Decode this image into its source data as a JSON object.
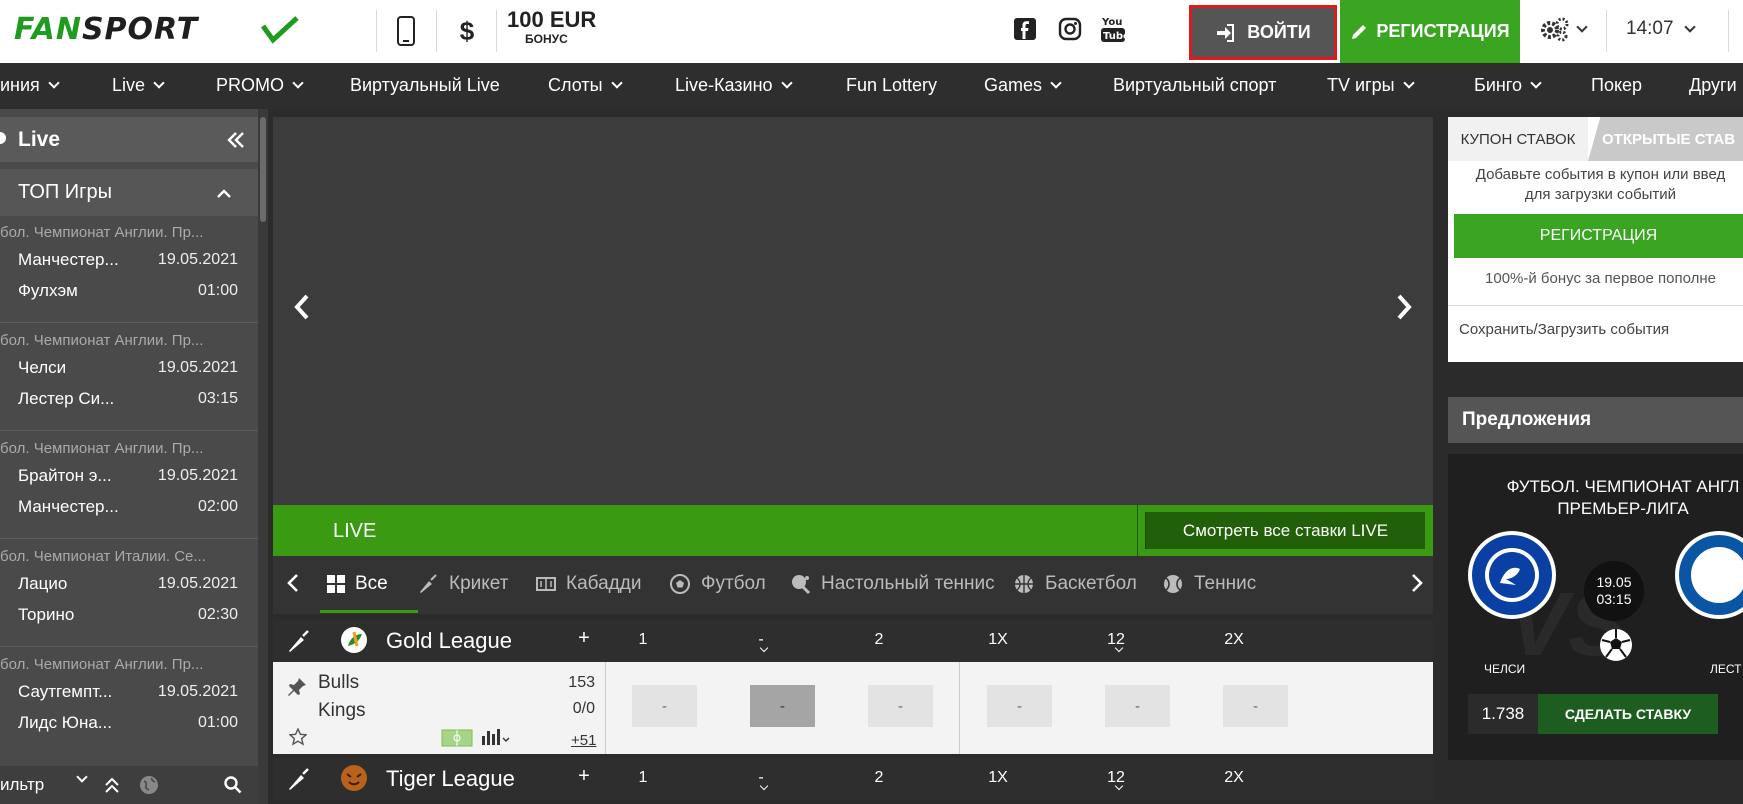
{
  "header": {
    "logo_text_1": "FAN",
    "logo_text_2": "SPORT",
    "currency_symbol": "$",
    "bonus_amount": "100 EUR",
    "bonus_label": "БОНУС",
    "login_label": "ВОЙТИ",
    "register_label": "РЕГИСТРАЦИЯ",
    "time": "14:07",
    "accent_green": "#3aa521",
    "login_highlight": "#e0191f"
  },
  "nav": {
    "items": [
      {
        "label": "иния",
        "dropdown": true
      },
      {
        "label": "Live",
        "dropdown": true
      },
      {
        "label": "PROMO",
        "dropdown": true
      },
      {
        "label": "Виртуальный Live",
        "dropdown": false
      },
      {
        "label": "Слоты",
        "dropdown": true
      },
      {
        "label": "Live-Казино",
        "dropdown": true
      },
      {
        "label": "Fun Lottery",
        "dropdown": false
      },
      {
        "label": "Games",
        "dropdown": true
      },
      {
        "label": "Виртуальный спорт",
        "dropdown": false
      },
      {
        "label": "TV игры",
        "dropdown": true
      },
      {
        "label": "Бинго",
        "dropdown": true
      },
      {
        "label": "Покер",
        "dropdown": false
      },
      {
        "label": "Други",
        "dropdown": false
      }
    ]
  },
  "sidebar": {
    "live_label": "Live",
    "top_games_label": "ТОП Игры",
    "matches": [
      {
        "league": "бол. Чемпионат Англии. Пр...",
        "team1": "Манчестер...",
        "team2": "Фулхэм",
        "date": "19.05.2021",
        "time": "01:00"
      },
      {
        "league": "бол. Чемпионат Англии. Пр...",
        "team1": "Челси",
        "team2": "Лестер Си...",
        "date": "19.05.2021",
        "time": "03:15"
      },
      {
        "league": "бол. Чемпионат Англии. Пр...",
        "team1": "Брайтон э...",
        "team2": "Манчестер...",
        "date": "19.05.2021",
        "time": "02:00"
      },
      {
        "league": "бол. Чемпионат Италии. Се...",
        "team1": "Лацио",
        "team2": "Торино",
        "date": "19.05.2021",
        "time": "02:30"
      },
      {
        "league": "бол. Чемпионат Англии. Пр...",
        "team1": "Саутгемпт...",
        "team2": "Лидс Юна...",
        "date": "19.05.2021",
        "time": "01:00"
      }
    ],
    "filter_label": "ильтр"
  },
  "main": {
    "live_label": "LIVE",
    "view_all_live": "Смотреть все ставки LIVE",
    "tabs": [
      {
        "label": "Все"
      },
      {
        "label": "Крикет"
      },
      {
        "label": "Кабадди"
      },
      {
        "label": "Футбол"
      },
      {
        "label": "Настольный теннис"
      },
      {
        "label": "Баскетбол"
      },
      {
        "label": "Теннис"
      }
    ],
    "columns": [
      "1",
      "-",
      "2",
      "1X",
      "12",
      "2X"
    ],
    "plus": "+",
    "leagues": [
      {
        "name": "Gold League"
      },
      {
        "name": "Tiger League"
      }
    ],
    "game": {
      "team1": "Bulls",
      "team2": "Kings",
      "score1": "153",
      "score2": "0/0",
      "more": "+51",
      "odds": [
        "-",
        "-",
        "-",
        "-",
        "-",
        "-"
      ]
    }
  },
  "coupon": {
    "tab_coupon": "КУПОН СТАВОК",
    "tab_open": "ОТКРЫТЫЕ СТАВ",
    "message_line1": "Добавьте события в купон или введ",
    "message_line2": "для загрузки событий",
    "register_label": "РЕГИСТРАЦИЯ",
    "bonus_text": "100%-й бонус за первое пополне",
    "save_load": "Сохранить/Загрузить события"
  },
  "offers": {
    "header": "Предложения",
    "title_line1": "ФУТБОЛ. ЧЕМПИОНАТ АНГЛ",
    "title_line2": "ПРЕМЬЕР-ЛИГА",
    "date": "19.05",
    "time": "03:15",
    "team1": "ЧЕЛСИ",
    "team2": "ЛЕСТ",
    "coef": "1.738",
    "bet_label": "СДЕЛАТЬ СТАВКУ"
  }
}
